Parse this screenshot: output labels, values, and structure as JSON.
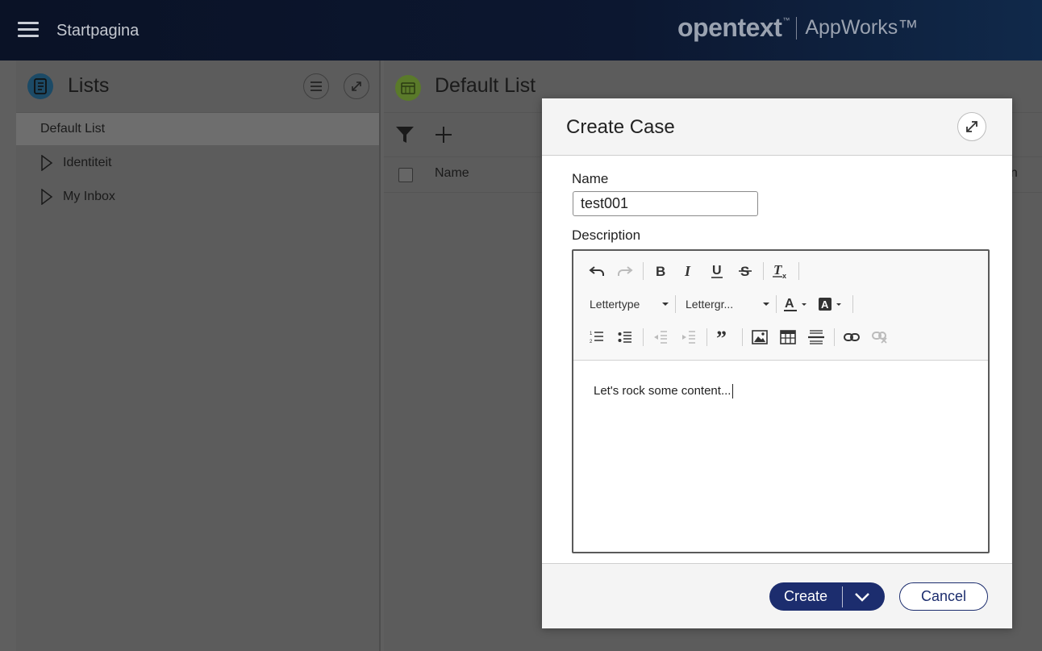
{
  "topbar": {
    "home_label": "Startpagina",
    "brand_name": "opentext",
    "brand_tm": "™",
    "brand_product": "AppWorks™"
  },
  "left_pane": {
    "title": "Lists",
    "icon": "list-icon",
    "selected_item": "Default List",
    "items": [
      {
        "label": "Identiteit"
      },
      {
        "label": "My Inbox"
      }
    ]
  },
  "right_pane": {
    "title": "Default List",
    "icon": "list-calendar-icon",
    "columns": [
      "Name",
      "tion"
    ]
  },
  "modal": {
    "title": "Create Case",
    "name_label": "Name",
    "name_value": "test001",
    "description_label": "Description",
    "font_dropdown": "Lettertype",
    "size_dropdown": "Lettergr...",
    "content": "Let's rock some content...",
    "create_label": "Create",
    "cancel_label": "Cancel"
  },
  "colors": {
    "primary": "#1c2d6e",
    "overlay": "#5f5f5f",
    "topbar": "#0c1730"
  }
}
